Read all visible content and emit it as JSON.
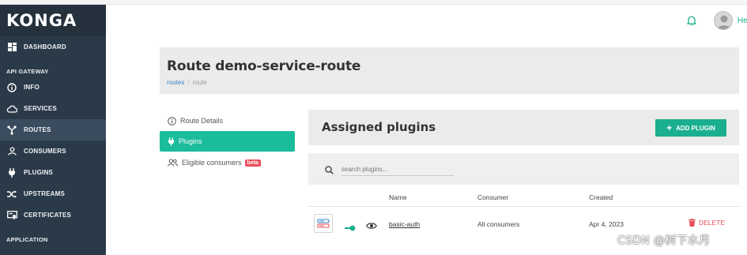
{
  "app": {
    "logo": "KONGA",
    "user_label": "He"
  },
  "sidebar": {
    "sections": {
      "api_gateway": "API GATEWAY",
      "application": "APPLICATION"
    },
    "items": [
      {
        "label": "DASHBOARD",
        "icon": "dashboard-icon"
      },
      {
        "label": "INFO",
        "icon": "info-icon"
      },
      {
        "label": "SERVICES",
        "icon": "cloud-icon"
      },
      {
        "label": "ROUTES",
        "icon": "routes-icon",
        "active": true
      },
      {
        "label": "CONSUMERS",
        "icon": "user-icon"
      },
      {
        "label": "PLUGINS",
        "icon": "plug-icon"
      },
      {
        "label": "UPSTREAMS",
        "icon": "shuffle-icon"
      },
      {
        "label": "CERTIFICATES",
        "icon": "certificate-icon"
      }
    ]
  },
  "header": {
    "title": "Route demo-service-route",
    "breadcrumb": [
      {
        "label": "routes",
        "link": true
      },
      {
        "label": "route",
        "link": false
      }
    ]
  },
  "tabs": [
    {
      "label": "Route Details",
      "icon": "info-circle-icon"
    },
    {
      "label": "Plugins",
      "icon": "plug-icon",
      "active": true
    },
    {
      "label": "Eligible consumers",
      "icon": "users-icon",
      "badge": "beta"
    }
  ],
  "plugins_panel": {
    "title": "Assigned plugins",
    "add_button": "ADD PLUGIN",
    "search_placeholder": "search plugins...",
    "columns": [
      "Name",
      "Consumer",
      "Created"
    ],
    "rows": [
      {
        "name": "basic-auth",
        "consumer": "All consumers",
        "created": "Apr 4, 2023",
        "delete_label": "DELETE"
      }
    ]
  },
  "watermark": "CSDN @树下水月",
  "colors": {
    "accent": "#1abc9c",
    "sidebar_bg": "#2b3a48",
    "danger": "#e84f5c"
  }
}
